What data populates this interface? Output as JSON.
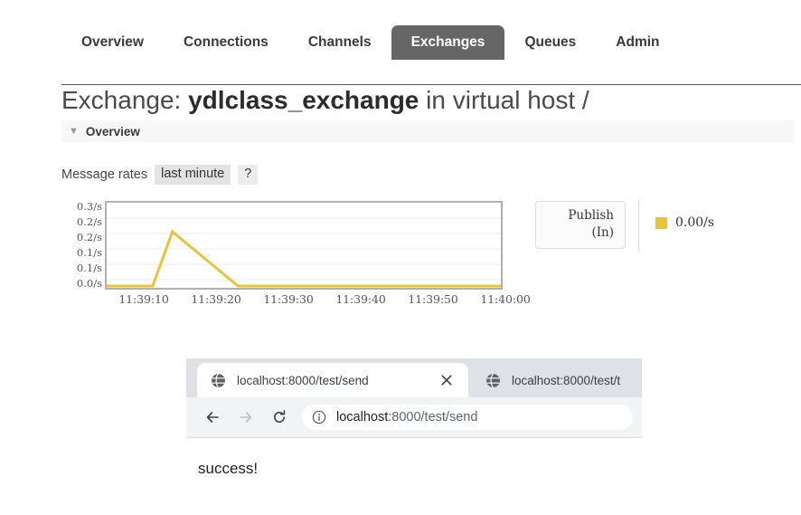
{
  "nav": {
    "tabs": [
      {
        "label": "Overview",
        "active": false
      },
      {
        "label": "Connections",
        "active": false
      },
      {
        "label": "Channels",
        "active": false
      },
      {
        "label": "Exchanges",
        "active": true
      },
      {
        "label": "Queues",
        "active": false
      },
      {
        "label": "Admin",
        "active": false
      }
    ]
  },
  "title": {
    "prefix": "Exchange: ",
    "name": "ydlclass_exchange",
    "suffix": " in virtual host /"
  },
  "section": {
    "arrow": "collapse-triangle-icon",
    "title": "Overview"
  },
  "rates": {
    "label": "Message rates",
    "period": "last minute",
    "help": "?"
  },
  "legend": {
    "button_line1": "Publish",
    "button_line2": "(In)",
    "swatch_color": "#e8c33c",
    "value": "0.00/s"
  },
  "browser": {
    "tabs": [
      {
        "title": "localhost:8000/test/send",
        "active": true
      },
      {
        "title": "localhost:8000/test/t",
        "active": false
      }
    ],
    "close_label": "×",
    "omnibox": {
      "host": "localhost",
      "path": ":8000/test/send"
    },
    "page_text": "success!"
  },
  "chart_data": {
    "type": "line",
    "title": "Message rates",
    "xlabel": "",
    "ylabel": "",
    "ylim": [
      0,
      0.3
    ],
    "grid": true,
    "legend_position": "right",
    "y_ticks": [
      "0.0/s",
      "0.1/s",
      "0.1/s",
      "0.2/s",
      "0.2/s",
      "0.3/s"
    ],
    "y_tick_values": [
      0.0,
      0.06,
      0.12,
      0.18,
      0.24,
      0.3
    ],
    "x_ticks": [
      "11:39:10",
      "11:39:20",
      "11:39:30",
      "11:39:40",
      "11:39:50",
      "11:40:00"
    ],
    "line_color": "#e8c33c",
    "series": [
      {
        "name": "Publish (In)",
        "color": "#e8c33c",
        "current_value": "0.00/s",
        "x": [
          "11:39:05",
          "11:39:10",
          "11:39:12",
          "11:39:15",
          "11:39:20",
          "11:39:25",
          "11:39:30",
          "11:39:40",
          "11:39:50",
          "11:40:00",
          "11:40:05"
        ],
        "values": [
          0.0,
          0.0,
          0.0,
          0.2,
          0.1,
          0.0,
          0.0,
          0.0,
          0.0,
          0.0,
          0.0
        ]
      }
    ]
  }
}
